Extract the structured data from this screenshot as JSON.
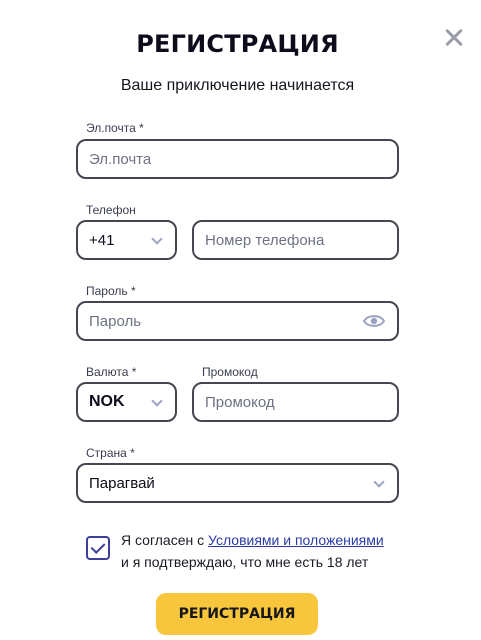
{
  "header": {
    "title": "РЕГИСТРАЦИЯ",
    "subtitle": "Ваше приключение начинается"
  },
  "email": {
    "label": "Эл.почта *",
    "placeholder": "Эл.почта"
  },
  "phone": {
    "label": "Телефон",
    "code": "+41",
    "placeholder": "Номер телефона"
  },
  "password": {
    "label": "Пароль *",
    "placeholder": "Пароль"
  },
  "currency": {
    "label": "Валюта *",
    "value": "NOK"
  },
  "promo": {
    "label": "Промокод",
    "placeholder": "Промокод"
  },
  "country": {
    "label": "Страна *",
    "value": "Парагвай"
  },
  "terms": {
    "checked": true,
    "prefix": "Я согласен с ",
    "link": "Условиями и положениями",
    "suffix": "и я подтверждаю, что мне есть 18 лет"
  },
  "submit_label": "РЕГИСТРАЦИЯ",
  "icons": {
    "close": "close-icon",
    "chevron": "chevron-down-icon",
    "eye": "eye-icon",
    "check": "checkmark-icon"
  },
  "colors": {
    "accent": "#f7c63c",
    "link": "#2a3aa8",
    "checkbox": "#3c3f9a",
    "border": "#45464f"
  }
}
